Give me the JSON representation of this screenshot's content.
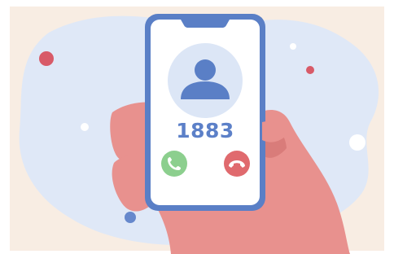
{
  "call": {
    "caller_number": "1883"
  },
  "icons": {
    "avatar": "person-silhouette-icon",
    "accept": "phone-accept-icon",
    "decline": "phone-decline-icon"
  },
  "colors": {
    "background": "#f8ede3",
    "blob": "#dfe8f7",
    "phone_frame": "#5a7fc6",
    "screen": "#ffffff",
    "avatar_circle": "#dce6f6",
    "avatar_figure": "#5a7fc6",
    "number_text": "#5c80c8",
    "accept_button": "#8ccf8e",
    "decline_button": "#e06a6e",
    "hand": "#e8918e",
    "hand_shadow": "#d97c7a",
    "dot_red": "#d85a68",
    "dot_blue": "#6688cc",
    "dot_white": "#ffffff"
  }
}
